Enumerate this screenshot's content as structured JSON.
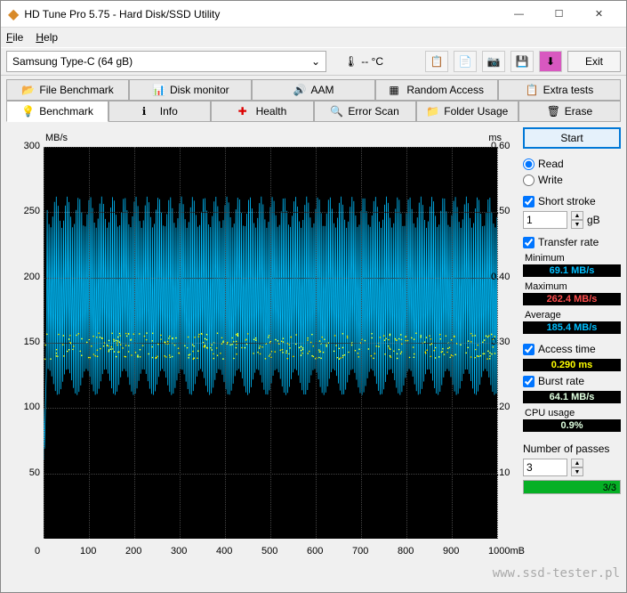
{
  "window": {
    "title": "HD Tune Pro 5.75 - Hard Disk/SSD Utility"
  },
  "menu": {
    "file": "File",
    "help": "Help"
  },
  "toolbar": {
    "device": "Samsung Type-C (64 gB)",
    "temp": "-- °C",
    "exit": "Exit"
  },
  "tabs_top": [
    {
      "label": "File Benchmark"
    },
    {
      "label": "Disk monitor"
    },
    {
      "label": "AAM"
    },
    {
      "label": "Random Access"
    },
    {
      "label": "Extra tests"
    }
  ],
  "tabs_bottom": [
    {
      "label": "Benchmark"
    },
    {
      "label": "Info"
    },
    {
      "label": "Health"
    },
    {
      "label": "Error Scan"
    },
    {
      "label": "Folder Usage"
    },
    {
      "label": "Erase"
    }
  ],
  "sidebar": {
    "start": "Start",
    "read": "Read",
    "write": "Write",
    "short_stroke": "Short stroke",
    "short_stroke_val": "1",
    "short_stroke_unit": "gB",
    "transfer_rate": "Transfer rate",
    "min_lbl": "Minimum",
    "min_val": "69.1 MB/s",
    "max_lbl": "Maximum",
    "max_val": "262.4 MB/s",
    "avg_lbl": "Average",
    "avg_val": "185.4 MB/s",
    "access_lbl": "Access time",
    "access_val": "0.290 ms",
    "burst_lbl": "Burst rate",
    "burst_val": "64.1 MB/s",
    "cpu_lbl": "CPU usage",
    "cpu_val": "0.9%",
    "passes_lbl": "Number of passes",
    "passes_val": "3",
    "progress_txt": "3/3"
  },
  "watermark": "www.ssd-tester.pl",
  "chart_data": {
    "type": "line",
    "title": "",
    "xlabel": "mB",
    "y1label": "MB/s",
    "y2label": "ms",
    "xlim": [
      0,
      1000
    ],
    "y1lim": [
      0,
      300
    ],
    "y2lim": [
      0,
      0.6
    ],
    "x_ticks": [
      0,
      100,
      200,
      300,
      400,
      500,
      600,
      700,
      800,
      900,
      1000
    ],
    "y1_ticks": [
      50,
      100,
      150,
      200,
      250,
      300
    ],
    "y2_ticks": [
      0.1,
      0.2,
      0.3,
      0.4,
      0.5,
      0.6
    ],
    "series": [
      {
        "name": "Transfer rate",
        "axis": "y1",
        "color": "#00bfff",
        "style": "dense-oscillation",
        "min": 69.1,
        "max": 262.4,
        "avg": 185.4,
        "note": "continuous oscillation roughly between 120 and 260 MB/s across full x range with initial dip near 69 at x≈0"
      },
      {
        "name": "Access time",
        "axis": "y2",
        "color": "#ffff00",
        "style": "scatter",
        "avg": 0.29,
        "note": "dense scatter around 0.28–0.31 ms across full x range"
      }
    ]
  }
}
